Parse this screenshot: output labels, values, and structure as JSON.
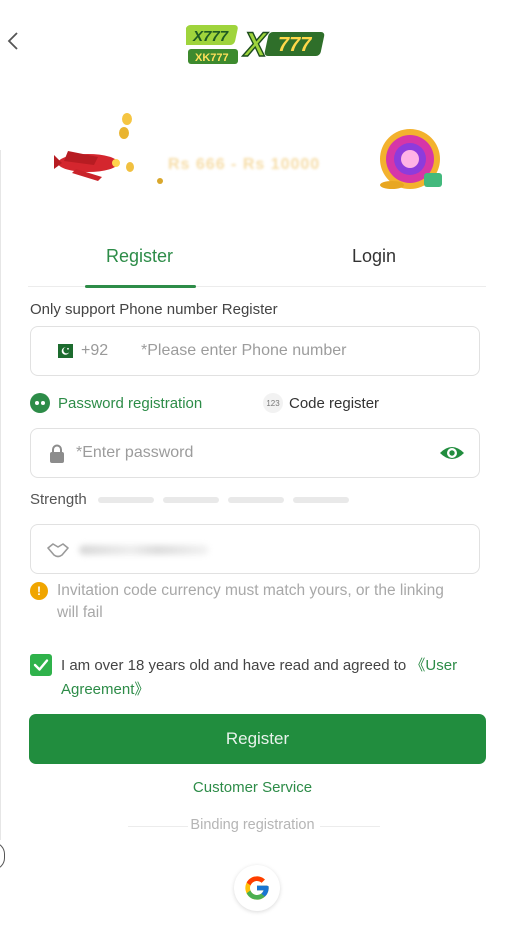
{
  "header": {
    "logo_left_top": "X777",
    "logo_left_bottom": "XK777",
    "logo_main": "X777"
  },
  "banner": {
    "amount": "Rs 666 - Rs 10000"
  },
  "tabs": [
    {
      "label": "Register",
      "active": true
    },
    {
      "label": "Login",
      "active": false
    }
  ],
  "form": {
    "support_note": "Only support Phone number Register",
    "phone": {
      "prefix": "+92",
      "placeholder": "*Please enter Phone number",
      "value": ""
    },
    "modes": {
      "password": "Password registration",
      "code_icon": "123",
      "code": "Code register"
    },
    "password": {
      "placeholder": "*Enter password",
      "value": ""
    },
    "strength_label": "Strength",
    "invite_warning": "Invitation code currency must match yours, or the linking will fail",
    "agree": {
      "checked": true,
      "text": "I am over 18 years old and have read and agreed to ",
      "link": "《User Agreement》"
    },
    "register_button": "Register"
  },
  "footer": {
    "customer_service": "Customer Service",
    "binding": "Binding registration"
  },
  "colors": {
    "accent": "#2d8c48",
    "button": "#218d3e",
    "warning": "#f0a500"
  },
  "icons": [
    "back-chevron-icon",
    "pakistan-flag-icon",
    "lock-icon",
    "eye-icon",
    "handshake-icon",
    "warning-icon",
    "check-icon",
    "google-icon"
  ]
}
